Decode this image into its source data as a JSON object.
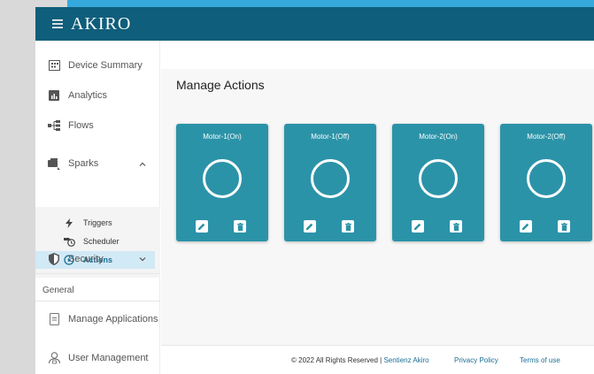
{
  "header": {
    "menu_icon": "hamburger-icon",
    "brand": "AKIRO"
  },
  "sidebar": {
    "items": [
      {
        "label": "Device Summary",
        "icon": "device-summary-icon"
      },
      {
        "label": "Analytics",
        "icon": "analytics-icon"
      },
      {
        "label": "Flows",
        "icon": "flows-icon"
      },
      {
        "label": "Sparks",
        "icon": "sparks-icon",
        "expanded": true
      },
      {
        "label": "Security",
        "icon": "security-icon",
        "expanded": false
      }
    ],
    "sparks_subitems": [
      {
        "label": "Triggers",
        "icon": "lightning-icon"
      },
      {
        "label": "Scheduler",
        "icon": "scheduler-icon"
      },
      {
        "label": "Actions",
        "icon": "play-circle-icon",
        "active": true
      }
    ],
    "general_label": "General",
    "general_items": [
      {
        "label": "Manage Applications",
        "icon": "applications-icon"
      },
      {
        "label": "User Management",
        "icon": "user-management-icon"
      }
    ]
  },
  "main": {
    "title": "Manage Actions",
    "cards": [
      {
        "title": "Motor-1(On)"
      },
      {
        "title": "Motor-1(Off)"
      },
      {
        "title": "Motor-2(On)"
      },
      {
        "title": "Motor-2(Off)"
      }
    ]
  },
  "footer": {
    "copyright": "© 2022 All Rights Reserved | ",
    "company": "Sentienz Akiro",
    "privacy": "Privacy Policy",
    "terms": "Terms of use"
  },
  "colors": {
    "header": "#0f5e7b",
    "card": "#2b93a8",
    "active": "#d2e9f6",
    "link": "#1b6f95"
  }
}
